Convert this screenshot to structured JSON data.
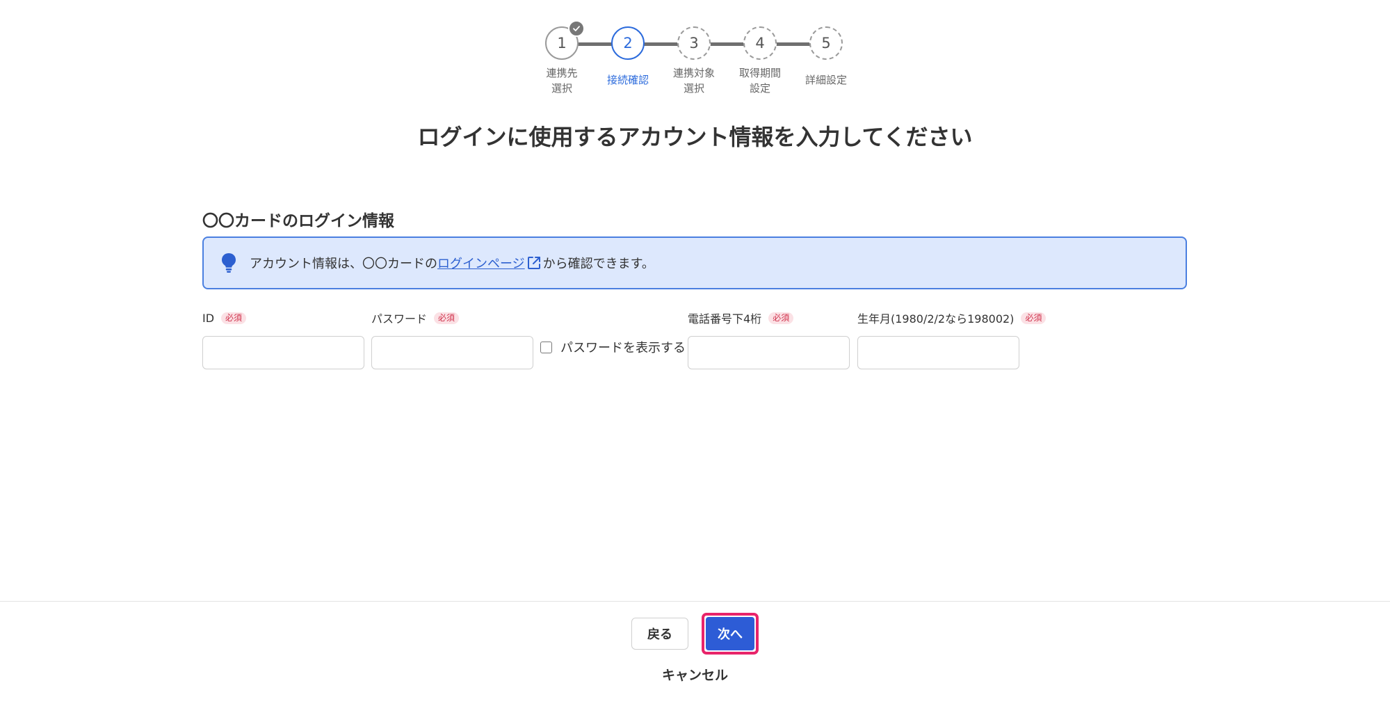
{
  "stepper": {
    "steps": [
      {
        "number": "1",
        "label": "連携先\n選択",
        "status": "done"
      },
      {
        "number": "2",
        "label": "接続確認",
        "status": "current"
      },
      {
        "number": "3",
        "label": "連携対象\n選択",
        "status": "todo"
      },
      {
        "number": "4",
        "label": "取得期間\n設定",
        "status": "todo"
      },
      {
        "number": "5",
        "label": "詳細設定",
        "status": "todo"
      }
    ]
  },
  "page": {
    "title": "ログインに使用するアカウント情報を入力してください"
  },
  "section": {
    "title": "〇〇カードのログイン情報",
    "info": {
      "prefix": "アカウント情報は、〇〇カードの",
      "link_text": "ログインページ",
      "suffix": "から確認できます。"
    }
  },
  "form": {
    "required_badge": "必須",
    "fields": [
      {
        "label": "ID",
        "value": ""
      },
      {
        "label": "パスワード",
        "value": ""
      },
      {
        "label": "電話番号下4桁",
        "value": ""
      },
      {
        "label": "生年月(1980/2/2なら198002)",
        "value": ""
      }
    ],
    "show_password_label": "パスワードを表示する",
    "show_password_checked": false
  },
  "footer": {
    "back_label": "戻る",
    "next_label": "次へ",
    "cancel_label": "キャンセル"
  },
  "colors": {
    "accent": "#2c6bdc",
    "primary_button": "#2d5cd6",
    "highlight_outline": "#e8246a",
    "info_bg": "#dde8fd",
    "required": "#d0324c"
  }
}
